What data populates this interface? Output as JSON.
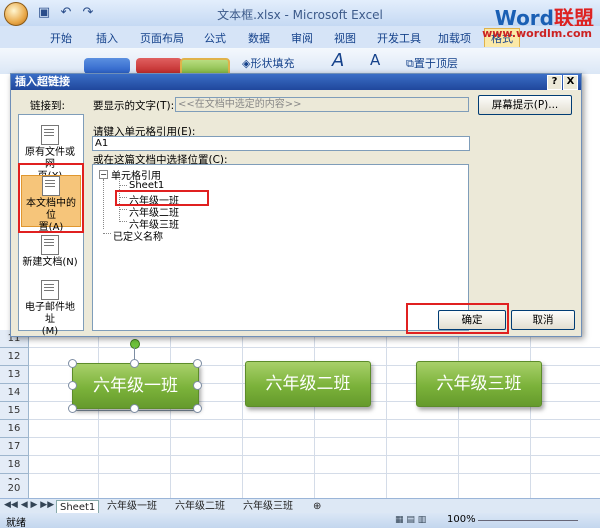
{
  "window": {
    "title": "文本框.xlsx - Microsoft Excel",
    "watermark": {
      "word": "Word",
      "rest": "联盟",
      "url": "www.wordlm.com"
    }
  },
  "ribbon": {
    "tabs": [
      "开始",
      "插入",
      "页面布局",
      "公式",
      "数据",
      "审阅",
      "视图",
      "开发工具",
      "加载项",
      "格式"
    ],
    "active_tab": "格式",
    "shape_fill_label": "形状填充",
    "bring_front_label": "置于顶层"
  },
  "dialog": {
    "title": "插入超链接",
    "help_btn": "?",
    "close_btn": "X",
    "link_to_label": "链接到:",
    "display_text_label": "要显示的文字(T):",
    "display_text_value": "<<在文档中选定的内容>>",
    "screen_tip_button": "屏幕提示(P)...",
    "cell_ref_label": "请键入单元格引用(E):",
    "cell_ref_value": "A1",
    "place_label": "或在这篇文档中选择位置(C):",
    "link_targets": [
      {
        "line1": "原有文件或网",
        "line2": "页(X)"
      },
      {
        "line1": "本文档中的位",
        "line2": "置(A)"
      },
      {
        "line1": "新建文档(N)",
        "line2": ""
      },
      {
        "line1": "电子邮件地址",
        "line2": "(M)"
      }
    ],
    "tree": {
      "root": "单元格引用",
      "children": [
        "Sheet1",
        "六年级一班",
        "六年级二班",
        "六年级三班"
      ],
      "defined_names": "已定义名称"
    },
    "ok_button": "确定",
    "cancel_button": "取消"
  },
  "sheet": {
    "row_numbers": [
      "11",
      "12",
      "13",
      "14",
      "15",
      "16",
      "17",
      "18",
      "19",
      "20"
    ],
    "shapes": [
      "六年级一班",
      "六年级二班",
      "六年级三班"
    ],
    "tabs": [
      "Sheet1",
      "六年级一班",
      "六年级二班",
      "六年级三班"
    ]
  },
  "status": {
    "ready": "就绪",
    "zoom": "100%"
  },
  "colors": {
    "shape_green": "#7bb23a",
    "highlight_red": "#e02020",
    "title_blue": "#20479c",
    "selected_orange": "#f6c57a"
  }
}
